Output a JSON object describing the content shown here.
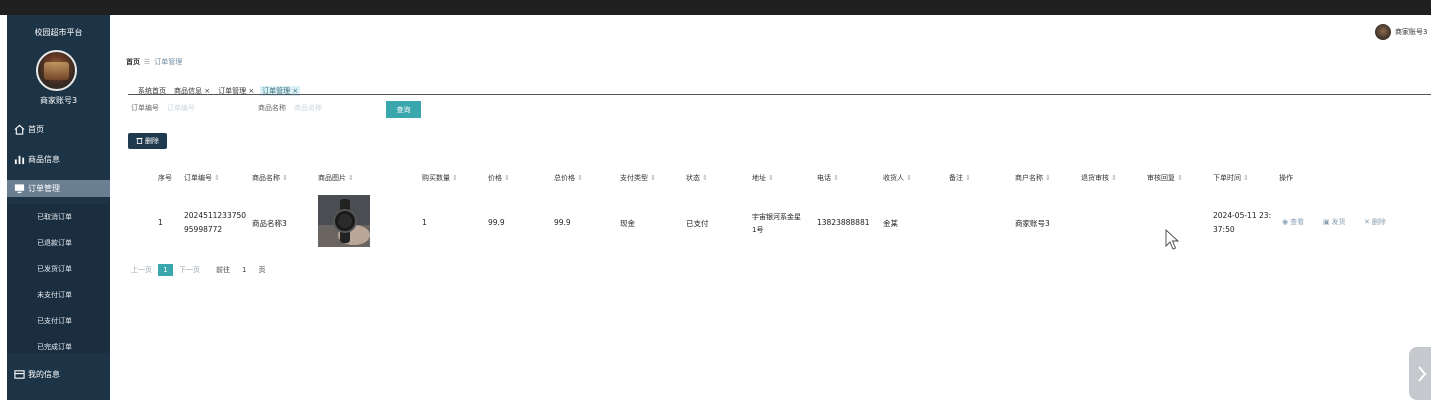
{
  "sidebar": {
    "brand": "校园超市平台",
    "username": "商家账号3",
    "items": [
      {
        "label": "首页",
        "icon": "home-icon"
      },
      {
        "label": "商品信息",
        "icon": "bar-chart-icon"
      },
      {
        "label": "订单管理",
        "icon": "monitor-icon"
      },
      {
        "label": "我的信息",
        "icon": "card-icon"
      }
    ],
    "sub_items": [
      "已取消订单",
      "已退款订单",
      "已发货订单",
      "未支付订单",
      "已支付订单",
      "已完成订单"
    ]
  },
  "header": {
    "user": "商家账号3"
  },
  "breadcrumb": {
    "home": "首页",
    "sep": "☰",
    "current": "订单管理"
  },
  "tabs": [
    "系统首页",
    "商品信息 ×",
    "订单管理 ×",
    "订单管理 ×"
  ],
  "filters": {
    "order_no_label": "订单编号",
    "order_no_placeholder": "订单编号",
    "product_name_label": "商品名称",
    "product_name_placeholder": "商品名称",
    "search_label": "查询"
  },
  "toolbar": {
    "delete_label": "删除"
  },
  "table": {
    "headers": [
      "序号",
      "订单编号",
      "商品名称",
      "商品图片",
      "购买数量",
      "价格",
      "总价格",
      "支付类型",
      "状态",
      "地址",
      "电话",
      "收货人",
      "备注",
      "商户名称",
      "退货审核",
      "审核回复",
      "下单时间",
      "操作"
    ],
    "row": {
      "index": "1",
      "order_no_1": "2024511233750",
      "order_no_2": "95998772",
      "product": "商品名称3",
      "qty": "1",
      "price": "99.9",
      "total": "99.9",
      "pay_type": "现金",
      "status": "已支付",
      "addr_1": "宇宙银河系金星",
      "addr_2": "1号",
      "phone": "13823888881",
      "receiver": "金某",
      "merchant": "商家账号3",
      "time_1": "2024-05-11 23:",
      "time_2": "37:50"
    },
    "ops": {
      "view": "查看",
      "ship": "发货",
      "delete": "删除"
    }
  },
  "pager": {
    "prev": "上一页",
    "page": "1",
    "next": "下一页",
    "goto": "前往",
    "goto_page": "1",
    "unit": "页"
  }
}
